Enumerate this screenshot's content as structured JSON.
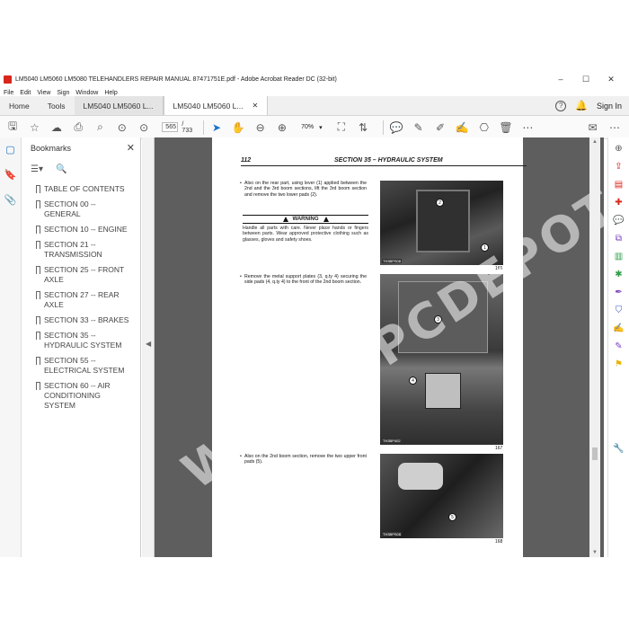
{
  "window": {
    "title": "LM5040 LM5060 LM5080 TELEHANDLERS REPAIR MANUAL 87471751E.pdf - Adobe Acrobat Reader DC (32-bit)",
    "controls": [
      "–",
      "☐",
      "✕"
    ]
  },
  "menu": [
    "File",
    "Edit",
    "View",
    "Sign",
    "Window",
    "Help"
  ],
  "tabs": {
    "home": "Home",
    "tools": "Tools",
    "doc1": "LM5040 LM5060 L...",
    "doc2": "LM5040 LM5060 L...",
    "sign_in": "Sign In"
  },
  "toolbar": {
    "page_current": "565",
    "page_total": "/ 733",
    "zoom": "70%"
  },
  "bookmarks": {
    "title": "Bookmarks",
    "items": [
      "TABLE OF CONTENTS",
      "SECTION 00 -- GENERAL",
      "SECTION 10 -- ENGINE",
      "SECTION 21 -- TRANSMISSION",
      "SECTION 25 -- FRONT AXLE",
      "SECTION 27 -- REAR AXLE",
      "SECTION 33 -- BRAKES",
      "SECTION 35 -- HYDRAULIC SYSTEM",
      "SECTION 55 -- ELECTRICAL SYSTEM",
      "SECTION 60 -- AIR CONDITIONING SYSTEM"
    ]
  },
  "page": {
    "number": "112",
    "section": "SECTION 35 – HYDRAULIC SYSTEM",
    "step1": "Also on the rear part, using lever (1) applied between the 2nd and the 3rd boom sections, lift the 3rd boom section and remove the two lower pads (2).",
    "warning_title": "WARNING",
    "warning_body": "Handle all parts with care. Never place hands or fingers between parts. Wear approved protective clothing such as glasses, gloves and safety shoes.",
    "step2": "Remove the metal support plates (3, q.ty 4) securing the side pads (4, q.ty 4) to the front of the 2nd boom section.",
    "step3": "Also on the 2nd boom section, remove the two upper front pads (5).",
    "fig1": {
      "label": "TH3BPS08",
      "num": "166",
      "callouts": [
        "2",
        "1"
      ]
    },
    "fig2": {
      "label": "TH3BP402",
      "num": "167",
      "callouts": [
        "3",
        "4"
      ]
    },
    "fig3": {
      "label": "TH3BPS08",
      "num": "168",
      "callouts": [
        "5"
      ]
    }
  },
  "watermark": "WWW.EPCDEPOT.COM"
}
